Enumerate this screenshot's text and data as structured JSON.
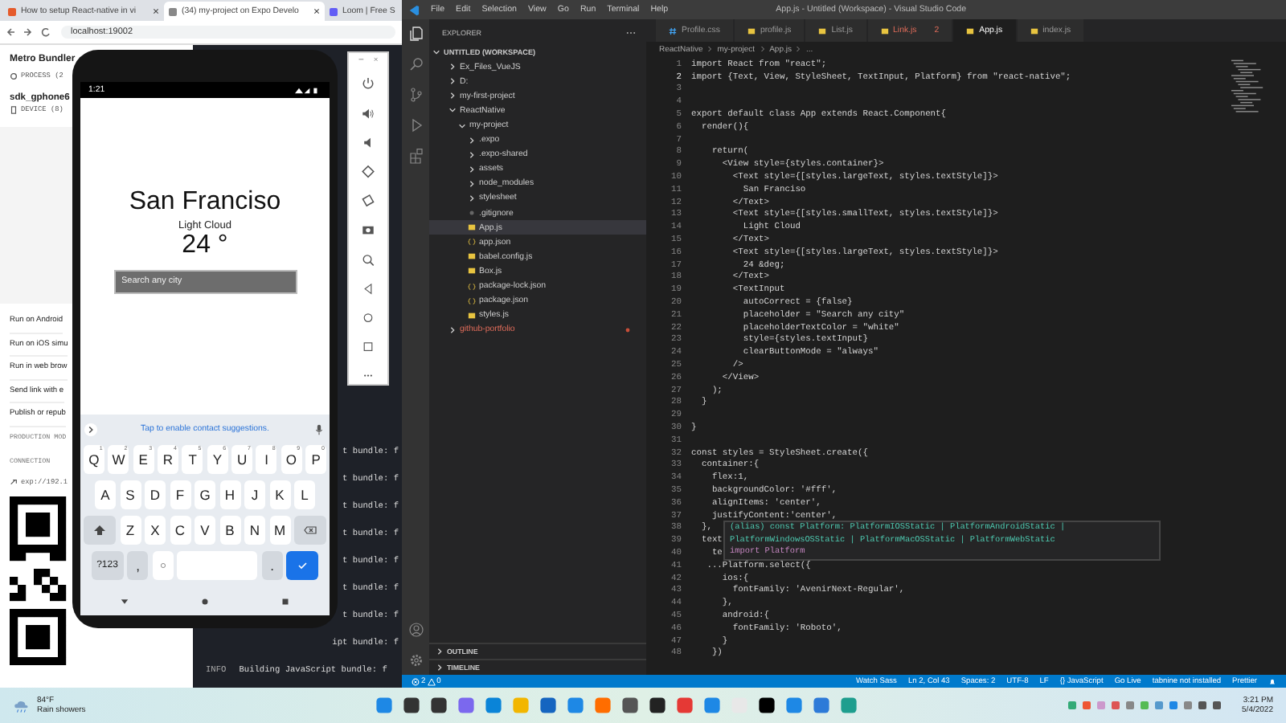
{
  "browser": {
    "tabs": [
      {
        "title": "How to setup React-native in vi",
        "selected": false
      },
      {
        "title": "(34) my-project on Expo Develo",
        "selected": true
      },
      {
        "title": "Loom | Free S",
        "selected": false
      }
    ],
    "address": "localhost:19002",
    "expo": {
      "title": "Metro Bundler",
      "process": "PROCESS (2",
      "device_name": "sdk_gphone6",
      "device": "DEVICE (8)",
      "actions": [
        "Run on Android",
        "Run on iOS simu",
        "Run in web brow",
        "Send link with e",
        "Publish or repub"
      ],
      "production_mode": "PRODUCTION MOD",
      "connection": "CONNECTION",
      "url": "exp://192.1"
    },
    "terminal": [
      {
        "text": "t bundle: f"
      },
      {
        "text": "t bundle: f"
      },
      {
        "text": "t bundle: f"
      },
      {
        "text": "t bundle: f"
      },
      {
        "text": "t bundle: f"
      },
      {
        "text": "t bundle: f"
      },
      {
        "text": "t bundle: f"
      },
      {
        "text": "ipt bundle: f"
      },
      {
        "tag": "INFO",
        "text": "Building JavaScript bundle: f"
      }
    ]
  },
  "phone": {
    "clock": "1:21",
    "city": "San Franciso",
    "weather": "Light Cloud",
    "temperature": "24 °",
    "search": {
      "placeholder": "Search any city"
    },
    "suggestion": "Tap to enable contact suggestions.",
    "keyboard": [
      [
        {
          "kind": "key",
          "label": "Q",
          "hint": "1"
        },
        {
          "kind": "key",
          "label": "W",
          "hint": "2"
        },
        {
          "kind": "key",
          "label": "E",
          "hint": "3"
        },
        {
          "kind": "key",
          "label": "R",
          "hint": "4"
        },
        {
          "kind": "key",
          "label": "T",
          "hint": "5"
        },
        {
          "kind": "key",
          "label": "Y",
          "hint": "6"
        },
        {
          "kind": "key",
          "label": "U",
          "hint": "7"
        },
        {
          "kind": "key",
          "label": "I",
          "hint": "8"
        },
        {
          "kind": "key",
          "label": "O",
          "hint": "9"
        },
        {
          "kind": "key",
          "label": "P",
          "hint": "0"
        }
      ],
      [
        {
          "kind": "key",
          "label": "A"
        },
        {
          "kind": "key",
          "label": "S"
        },
        {
          "kind": "key",
          "label": "D"
        },
        {
          "kind": "key",
          "label": "F"
        },
        {
          "kind": "key",
          "label": "G"
        },
        {
          "kind": "key",
          "label": "H"
        },
        {
          "kind": "key",
          "label": "J"
        },
        {
          "kind": "key",
          "label": "K"
        },
        {
          "kind": "key",
          "label": "L"
        }
      ],
      [
        {
          "kind": "shift"
        },
        {
          "kind": "key",
          "label": "Z"
        },
        {
          "kind": "key",
          "label": "X"
        },
        {
          "kind": "key",
          "label": "C"
        },
        {
          "kind": "key",
          "label": "V"
        },
        {
          "kind": "key",
          "label": "B"
        },
        {
          "kind": "key",
          "label": "N"
        },
        {
          "kind": "key",
          "label": "M"
        },
        {
          "kind": "backspace"
        }
      ],
      [
        {
          "kind": "mode",
          "label": "?123"
        },
        {
          "kind": "punct",
          "label": ","
        },
        {
          "kind": "emoji"
        },
        {
          "kind": "space"
        },
        {
          "kind": "punct",
          "label": "."
        },
        {
          "kind": "enter"
        }
      ]
    ]
  },
  "vscode": {
    "menu": [
      "File",
      "Edit",
      "Selection",
      "View",
      "Go",
      "Run",
      "Terminal",
      "Help"
    ],
    "title": "App.js - Untitled (Workspace) - Visual Studio Code",
    "explorer": {
      "title": "EXPLORER",
      "workspace": "UNTITLED (WORKSPACE)",
      "tree": [
        {
          "name": "Ex_Files_VueJS",
          "kind": "folder",
          "expanded": false,
          "selected": false,
          "modified": false
        },
        {
          "name": "D:",
          "kind": "folder",
          "expanded": false,
          "selected": false,
          "modified": false
        },
        {
          "name": "my-first-project",
          "kind": "folder",
          "expanded": false,
          "selected": false,
          "modified": false
        },
        {
          "name": "ReactNative",
          "kind": "folder",
          "expanded": true,
          "selected": false,
          "modified": false,
          "children": [
            {
              "name": "my-project",
              "kind": "folder",
              "expanded": true,
              "selected": false,
              "modified": false,
              "children": [
                {
                  "name": ".expo",
                  "kind": "folder",
                  "expanded": false,
                  "selected": false,
                  "modified": false
                },
                {
                  "name": ".expo-shared",
                  "kind": "folder",
                  "expanded": false,
                  "selected": false,
                  "modified": false
                },
                {
                  "name": "assets",
                  "kind": "folder",
                  "expanded": false,
                  "selected": false,
                  "modified": false
                },
                {
                  "name": "node_modules",
                  "kind": "folder",
                  "expanded": false,
                  "selected": false,
                  "modified": false
                },
                {
                  "name": "stylesheet",
                  "kind": "folder",
                  "expanded": false,
                  "selected": false,
                  "modified": false
                },
                {
                  "name": ".gitignore",
                  "kind": "gitignore",
                  "selected": false,
                  "modified": false
                },
                {
                  "name": "App.js",
                  "kind": "js",
                  "selected": true,
                  "modified": false
                },
                {
                  "name": "app.json",
                  "kind": "json",
                  "selected": false,
                  "modified": false
                },
                {
                  "name": "babel.config.js",
                  "kind": "babel",
                  "selected": false,
                  "modified": false
                },
                {
                  "name": "Box.js",
                  "kind": "js",
                  "selected": false,
                  "modified": false
                },
                {
                  "name": "package-lock.json",
                  "kind": "json",
                  "selected": false,
                  "modified": false
                },
                {
                  "name": "package.json",
                  "kind": "json",
                  "selected": false,
                  "modified": false
                },
                {
                  "name": "styles.js",
                  "kind": "js",
                  "selected": false,
                  "modified": false
                }
              ]
            }
          ]
        },
        {
          "name": "github-portfolio",
          "kind": "folder",
          "expanded": false,
          "selected": false,
          "modified": true
        }
      ],
      "sections": [
        "OUTLINE",
        "TIMELINE"
      ]
    },
    "tabs": [
      {
        "label": "Profile.css",
        "kind": "css",
        "selected": false,
        "modified": false
      },
      {
        "label": "profile.js",
        "kind": "js",
        "selected": false,
        "modified": false
      },
      {
        "label": "List.js",
        "kind": "js",
        "selected": false,
        "modified": false
      },
      {
        "label": "Link.js",
        "kind": "js",
        "selected": false,
        "modified": true,
        "problems": "2"
      },
      {
        "label": "App.js",
        "kind": "js",
        "selected": true,
        "modified": false
      },
      {
        "label": "index.js",
        "kind": "js",
        "selected": false,
        "modified": false
      }
    ],
    "breadcrumb": [
      "ReactNative",
      "my-project",
      "App.js",
      "..."
    ],
    "code": [
      {
        "n": "1",
        "current": false,
        "text": "import React from \"react\";"
      },
      {
        "n": "2",
        "current": true,
        "text": "import {Text, View, StyleSheet, TextInput, Platform} from \"react-native\";"
      },
      {
        "n": "3",
        "current": false
      },
      {
        "n": "4",
        "current": false
      },
      {
        "n": "5",
        "current": false,
        "text": "export default class App extends React.Component{"
      },
      {
        "n": "6",
        "current": false,
        "text": "  render(){"
      },
      {
        "n": "7",
        "current": false
      },
      {
        "n": "8",
        "current": false,
        "text": "    return("
      },
      {
        "n": "9",
        "current": false,
        "text": "      <View style={styles.container}>"
      },
      {
        "n": "10",
        "current": false,
        "text": "        <Text style={[styles.largeText, styles.textStyle]}>"
      },
      {
        "n": "11",
        "current": false,
        "text": "          San Franciso"
      },
      {
        "n": "12",
        "current": false,
        "text": "        </Text>"
      },
      {
        "n": "13",
        "current": false,
        "text": "        <Text style={[styles.smallText, styles.textStyle]}>"
      },
      {
        "n": "14",
        "current": false,
        "text": "          Light Cloud"
      },
      {
        "n": "15",
        "current": false,
        "text": "        </Text>"
      },
      {
        "n": "16",
        "current": false,
        "text": "        <Text style={[styles.largeText, styles.textStyle]}>"
      },
      {
        "n": "17",
        "current": false,
        "text": "          24 &deg;"
      },
      {
        "n": "18",
        "current": false,
        "text": "        </Text>"
      },
      {
        "n": "19",
        "current": false,
        "text": "        <TextInput"
      },
      {
        "n": "20",
        "current": false,
        "text": "          autoCorrect = {false}"
      },
      {
        "n": "21",
        "current": false,
        "text": "          placeholder = \"Search any city\""
      },
      {
        "n": "22",
        "current": false,
        "text": "          placeholderTextColor = \"white\""
      },
      {
        "n": "23",
        "current": false,
        "text": "          style={styles.textInput}"
      },
      {
        "n": "24",
        "current": false,
        "text": "          clearButtonMode = \"always\""
      },
      {
        "n": "25",
        "current": false,
        "text": "        />"
      },
      {
        "n": "26",
        "current": false,
        "text": "      </View>"
      },
      {
        "n": "27",
        "current": false,
        "text": "    );"
      },
      {
        "n": "28",
        "current": false,
        "text": "  }"
      },
      {
        "n": "29",
        "current": false
      },
      {
        "n": "30",
        "current": false,
        "text": "}"
      },
      {
        "n": "31",
        "current": false
      },
      {
        "n": "32",
        "current": false,
        "text": "const styles = StyleSheet.create({"
      },
      {
        "n": "33",
        "current": false,
        "text": "  container:{"
      },
      {
        "n": "34",
        "current": false,
        "text": "    flex:1,"
      },
      {
        "n": "35",
        "current": false,
        "text": "    backgroundColor: '#fff',"
      },
      {
        "n": "36",
        "current": false,
        "text": "    alignItems: 'center',"
      },
      {
        "n": "37",
        "current": false,
        "text": "    justifyContent:'center',"
      },
      {
        "n": "38",
        "current": false,
        "text": "  },"
      },
      {
        "n": "39",
        "current": false,
        "text": "  text"
      },
      {
        "n": "40",
        "current": false,
        "text": "    te"
      },
      {
        "n": "41",
        "current": false,
        "text": "   ...Platform.select({"
      },
      {
        "n": "42",
        "current": false,
        "text": "      ios:{"
      },
      {
        "n": "43",
        "current": false,
        "text": "        fontFamily: 'AvenirNext-Regular',"
      },
      {
        "n": "44",
        "current": false,
        "text": "      },"
      },
      {
        "n": "45",
        "current": false,
        "text": "      android:{"
      },
      {
        "n": "46",
        "current": false,
        "text": "        fontFamily: 'Roboto',"
      },
      {
        "n": "47",
        "current": false,
        "text": "      }"
      },
      {
        "n": "48",
        "current": false,
        "text": "    })"
      }
    ],
    "hover": [
      "(alias) const Platform: PlatformIOSStatic | PlatformAndroidStatic |",
      "PlatformWindowsOSStatic | PlatformMacOSStatic | PlatformWebStatic",
      "import Platform"
    ],
    "status": {
      "errors": "2",
      "warnings": "0",
      "items": [
        "Watch Sass",
        "Ln 2, Col 43",
        "Spaces: 2",
        "UTF-8",
        "LF",
        "{} JavaScript",
        "Go Live",
        "tabnine not installed",
        "Prettier"
      ]
    }
  },
  "taskbar": {
    "temperature": "84°F",
    "weather": "Rain showers",
    "time": "3:21 PM",
    "date": "5/4/2022"
  }
}
